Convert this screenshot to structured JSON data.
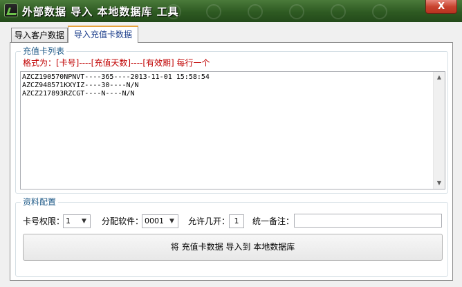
{
  "window": {
    "title": "外部数据 导入 本地数据库 工具",
    "close_label": "X"
  },
  "tabs": [
    {
      "label": "导入客户数据",
      "active": false
    },
    {
      "label": "导入充值卡数据",
      "active": true
    }
  ],
  "card_group": {
    "legend": "充值卡列表",
    "format_hint": "格式为：[卡号]----[充值天数]----[有效期] 每行一个",
    "content": "AZCZ190570NPNVT----365----2013-11-01 15:58:54\nAZCZ948571KXYIZ----30----N/N\nAZCZ217893RZCGT----N----N/N"
  },
  "config_group": {
    "legend": "资料配置",
    "card_permission_label": "卡号权限：",
    "card_permission_value": "1",
    "software_label": "分配软件：",
    "software_value": "0001",
    "allow_open_label": "允许几开：",
    "allow_open_value": "1",
    "remark_label": "统一备注：",
    "remark_value": "",
    "import_button_label": "将 充值卡数据 导入到 本地数据库"
  },
  "colors": {
    "titlebar": "#2e5a22",
    "legend": "#1d5987",
    "format_hint": "#c00000",
    "close_button": "#c9442f"
  }
}
